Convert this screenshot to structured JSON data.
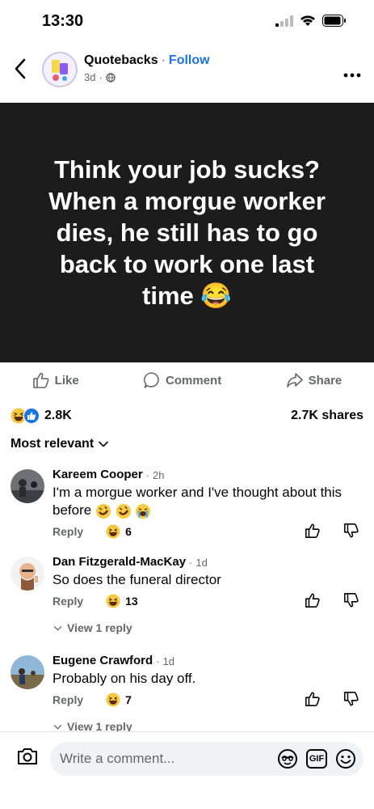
{
  "status_bar": {
    "time": "13:30"
  },
  "header": {
    "page_name": "Quotebacks",
    "separator": "·",
    "follow_label": "Follow",
    "post_age": "3d",
    "meta_sep": "·"
  },
  "post": {
    "image_text": "Think your job sucks? When a morgue worker dies, he still has to go back to work one last time 😂"
  },
  "actions": {
    "like": "Like",
    "comment": "Comment",
    "share": "Share"
  },
  "stats": {
    "reactions_count": "2.8K",
    "shares": "2.7K shares"
  },
  "sort": {
    "label": "Most relevant"
  },
  "comments": [
    {
      "author": "Kareem Cooper",
      "time": "2h",
      "text": "I'm a morgue worker and I've thought about this before",
      "reply_label": "Reply",
      "reaction_count": "6"
    },
    {
      "author": "Dan Fitzgerald-MacKay",
      "time": "1d",
      "text": "So does the funeral director",
      "reply_label": "Reply",
      "reaction_count": "13",
      "view_replies": "View 1 reply"
    },
    {
      "author": "Eugene Crawford",
      "time": "1d",
      "text": "Probably on his day off.",
      "reply_label": "Reply",
      "reaction_count": "7",
      "view_replies": "View 1 reply"
    }
  ],
  "composer": {
    "placeholder": "Write a comment...",
    "gif_label": "GIF"
  },
  "colors": {
    "accent": "#1b74e4",
    "image_bg": "#1c1c1c",
    "muted": "#65676b"
  }
}
